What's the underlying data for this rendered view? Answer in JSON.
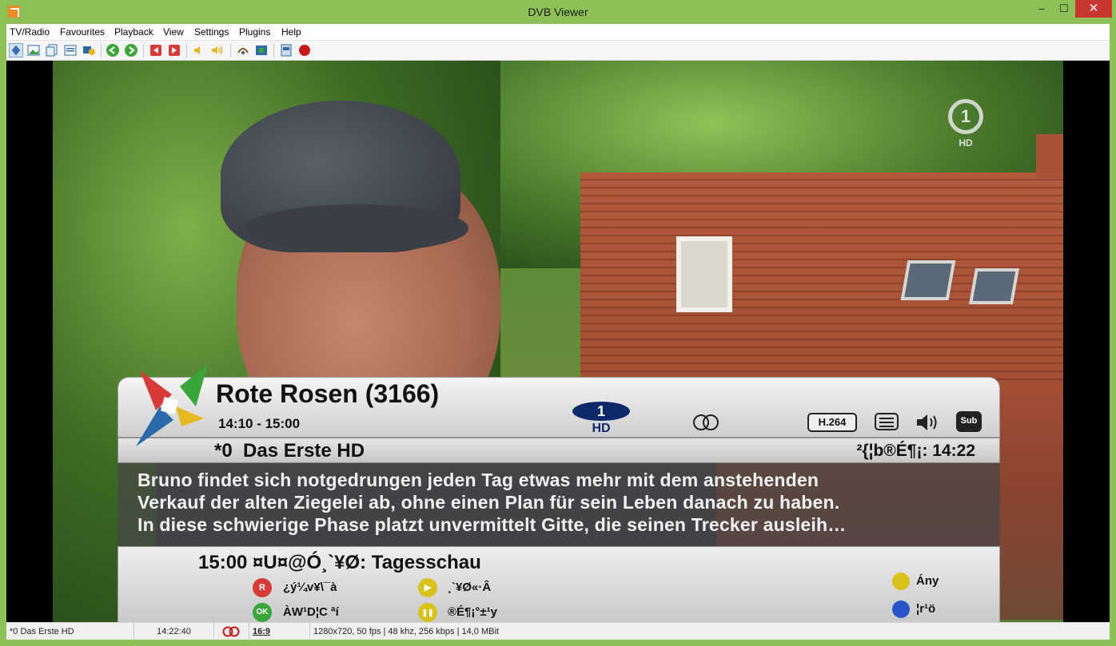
{
  "window": {
    "title": "DVB Viewer",
    "minimize": "–",
    "maximize": "☐",
    "close": "✕"
  },
  "menu": [
    "TV/Radio",
    "Favourites",
    "Playback",
    "View",
    "Settings",
    "Plugins",
    "Help"
  ],
  "toolbar_icons": [
    "osd-icon",
    "picture-icon",
    "copy-icon",
    "teletext-icon",
    "epg-icon",
    "back-icon",
    "forward-icon",
    "prev-channel-icon",
    "next-channel-icon",
    "volume-down-icon",
    "volume-up-icon",
    "timeshift-icon",
    "snapshot-icon",
    "recorder-icon",
    "record-icon"
  ],
  "video": {
    "channel_logo_text": "1",
    "channel_logo_sub": "HD"
  },
  "osd": {
    "title": "Rote Rosen (3166)",
    "time_range": "14:10 - 15:00",
    "codec": "H.264",
    "subtitle_badge": "Sub",
    "hd_logo_number": "1",
    "hd_logo_text": "HD",
    "channel": "*0  Das Erste HD",
    "clock": "²{¦b®É¶¡: 14:22",
    "description": [
      "Bruno findet sich notgedrungen jeden Tag etwas mehr mit dem anstehenden",
      "Verkauf der alten Ziegelei ab, ohne einen Plan für sein Leben danach zu haben.",
      "In diese schwierige Phase platzt unvermittelt Gitte, die seinen Trecker ausleih…"
    ],
    "next": "15:00 ¤U¤@Ó¸`¥Ø: Tagesschau",
    "options": [
      {
        "badge": "R",
        "label": "¿ý¼v¥\\¯à",
        "color": "#d83a3a"
      },
      {
        "badge": "▶",
        "label": "¸`¥Ø«·Â",
        "color": "#d9c21a"
      },
      {
        "badge": "OK",
        "label": "ÀW¹D¦C ªí",
        "color": "#3aa63a"
      },
      {
        "badge": "❚❚",
        "label": "®É¶¡°±¹y",
        "color": "#d9c21a"
      }
    ],
    "color_keys": [
      {
        "label": "Ány",
        "color": "#d9c21a"
      },
      {
        "label": "¦r¹ö",
        "color": "#2a55c8"
      }
    ]
  },
  "status": {
    "channel": "*0 Das Erste HD",
    "time": "14:22:40",
    "aspect": "16:9",
    "info": "1280x720, 50 fps | 48 khz, 256 kbps | 14,0 MBit"
  }
}
